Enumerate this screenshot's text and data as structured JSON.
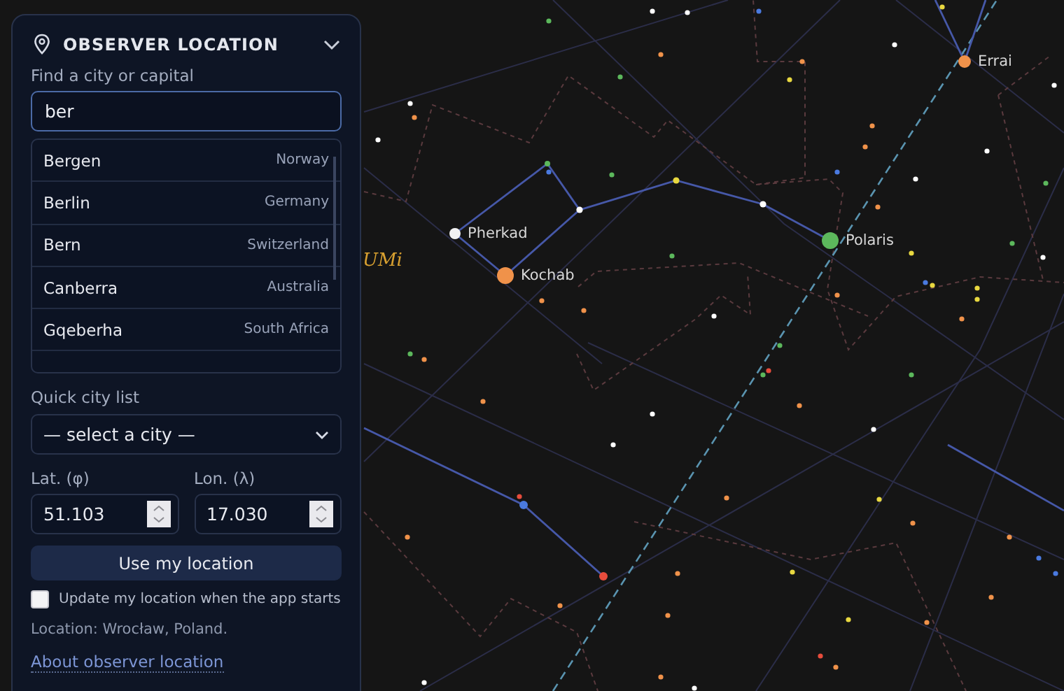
{
  "sky": {
    "constellation_label": "UMi",
    "stars": [
      {
        "name": "Pherkad",
        "color": "#f2f2f2"
      },
      {
        "name": "Kochab",
        "color": "#f0924a"
      },
      {
        "name": "Polaris",
        "color": "#5cb85c"
      },
      {
        "name": "Errai",
        "color": "#f0924a"
      }
    ]
  },
  "panel": {
    "title": "OBSERVER LOCATION",
    "search": {
      "label": "Find a city or capital",
      "value": "ber"
    },
    "results": [
      {
        "city": "Bergen",
        "country": "Norway"
      },
      {
        "city": "Berlin",
        "country": "Germany"
      },
      {
        "city": "Bern",
        "country": "Switzerland"
      },
      {
        "city": "Canberra",
        "country": "Australia"
      },
      {
        "city": "Gqeberha",
        "country": "South Africa"
      }
    ],
    "quick_list": {
      "label": "Quick city list",
      "value": "— select a city —"
    },
    "latitude": {
      "label": "Lat. (φ)",
      "value": "51.103"
    },
    "longitude": {
      "label": "Lon. (λ)",
      "value": "17.030"
    },
    "button": "Use my location",
    "auto_update": {
      "label": "Update my location when the app starts",
      "checked": false
    },
    "location_text": "Location: Wrocław, Poland.",
    "link": "About observer location"
  }
}
